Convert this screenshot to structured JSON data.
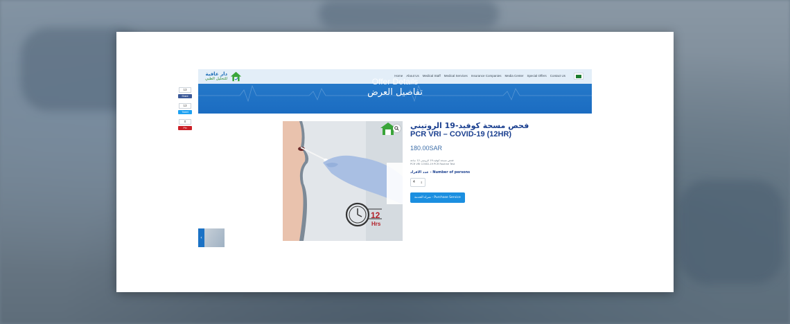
{
  "header": {
    "logo": {
      "name_ar": "دار عافية",
      "subtitle_ar": "للتحليل الطبي"
    },
    "nav_items": [
      "Home",
      "About Us",
      "Medical Staff",
      "Medical Services",
      "Insurance Companies",
      "Media Center",
      "Special Offers",
      "Contact Us"
    ],
    "language_flag": "flag-icon"
  },
  "banner": {
    "title_en": "Offer Details",
    "title_ar": "تفاصيل العرض"
  },
  "share": {
    "facebook": {
      "count": "13",
      "label": "Share"
    },
    "twitter": {
      "count": "13",
      "label": "Tweet"
    },
    "pinterest": {
      "count": "0",
      "label": "Pin"
    }
  },
  "product": {
    "title_ar": "فحص مسحة كوفيد-19 الروتيني",
    "title_en": "PCR VRI – COVID-19 (12HR)",
    "price": "180.00SAR",
    "description_ar": "فحص مسحة كوفيد-19 الروتيني 12 ساعة",
    "description_en": "PCR VRI COVID-19 PCR Routine Test",
    "persons_label": "عدد الافراد - Number of persons",
    "quantity": "4",
    "buy_button": "شراء الخدمة - Purchase Service",
    "image_badge": "12",
    "image_badge_unit": "Hrs"
  },
  "colors": {
    "accent": "#1b8fe0",
    "banner": "#1b6cc1",
    "title": "#1a3f8f",
    "logo_green": "#2f8a2f"
  }
}
